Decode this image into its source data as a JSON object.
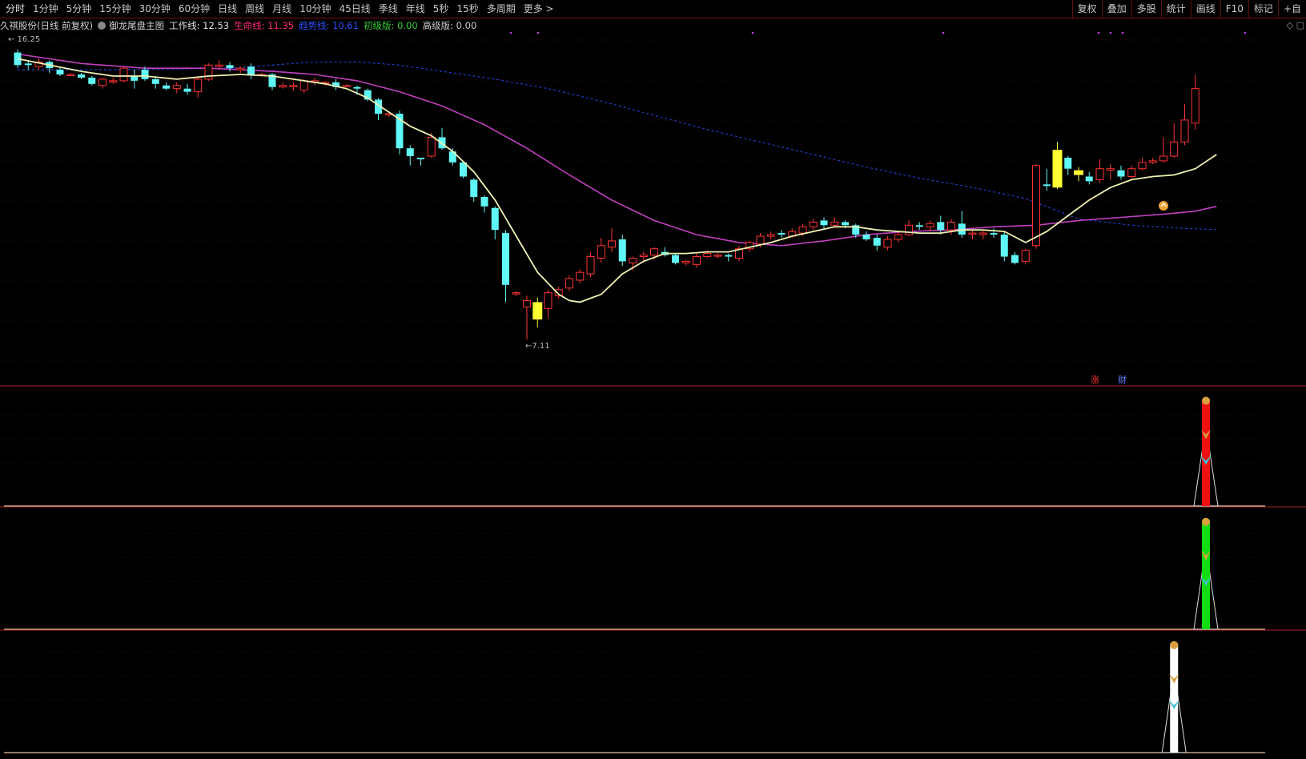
{
  "toolbar": {
    "periods": [
      "分时",
      "1分钟",
      "5分钟",
      "15分钟",
      "30分钟",
      "60分钟",
      "日线",
      "周线",
      "月线",
      "10分钟",
      "45日线",
      "季线",
      "年线",
      "5秒",
      "15秒",
      "多周期",
      "更多 >"
    ],
    "right": [
      "复权",
      "叠加",
      "多股",
      "统计",
      "画线",
      "F10",
      "标记",
      "+自"
    ]
  },
  "indicator_bar": {
    "stock": "久祺股份(日线 前复权)",
    "formula": "御龙尾盘主图",
    "work_line": "工作线: 12.53",
    "life_line": "生命线: 11.35",
    "trend_line": "趋势线: 10.61",
    "basic": "初级版: 0.00",
    "advanced": "高级版: 0.00"
  },
  "right_icons": "◇ ▢",
  "price_labels": {
    "high": "16.25",
    "low": "7.11"
  },
  "markers": {
    "zhang": "涨",
    "cai": "财"
  },
  "colors": {
    "up": "#ff3333",
    "down": "#5ff7f7",
    "special": "#ffff33",
    "work": "#f0f0b0",
    "life": "#c040c0",
    "trend": "#2040d0",
    "life_label": "#ff2a7a",
    "trend_label": "#3050ff",
    "basic_label": "#33cc33",
    "panel1": "#ee1111",
    "panel2": "#11dd11",
    "panel3": "#ffffff"
  },
  "chart_data": {
    "type": "candlestick",
    "ylim": [
      6.5,
      16.8
    ],
    "high_label": 16.25,
    "low_label": 7.11,
    "candles": [
      [
        16.25,
        15.85,
        16.35,
        15.75
      ],
      [
        15.9,
        15.85,
        16.0,
        15.7
      ],
      [
        15.8,
        15.95,
        16.05,
        15.7
      ],
      [
        15.95,
        15.75,
        16.0,
        15.6
      ],
      [
        15.7,
        15.55,
        15.8,
        15.5
      ],
      [
        15.55,
        15.55,
        15.6,
        15.5
      ],
      [
        15.55,
        15.45,
        15.6,
        15.4
      ],
      [
        15.45,
        15.25,
        15.5,
        15.2
      ],
      [
        15.2,
        15.4,
        15.45,
        15.1
      ],
      [
        15.35,
        15.35,
        15.45,
        15.25
      ],
      [
        15.35,
        15.75,
        15.8,
        15.3
      ],
      [
        15.5,
        15.35,
        15.7,
        15.1
      ],
      [
        15.7,
        15.4,
        15.8,
        15.35
      ],
      [
        15.4,
        15.25,
        15.5,
        15.1
      ],
      [
        15.2,
        15.1,
        15.3,
        15.05
      ],
      [
        15.1,
        15.2,
        15.3,
        14.95
      ],
      [
        15.1,
        15.0,
        15.25,
        14.9
      ],
      [
        15.0,
        15.4,
        15.45,
        14.8
      ],
      [
        15.4,
        15.85,
        15.9,
        15.35
      ],
      [
        15.8,
        15.85,
        16.0,
        15.7
      ],
      [
        15.85,
        15.75,
        15.95,
        15.65
      ],
      [
        15.7,
        15.75,
        15.8,
        15.6
      ],
      [
        15.8,
        15.55,
        15.9,
        15.4
      ],
      [
        15.55,
        15.55,
        15.6,
        15.5
      ],
      [
        15.55,
        15.15,
        15.6,
        15.05
      ],
      [
        15.15,
        15.2,
        15.3,
        15.1
      ],
      [
        15.2,
        15.2,
        15.3,
        15.05
      ],
      [
        15.05,
        15.35,
        15.4,
        14.95
      ],
      [
        15.3,
        15.35,
        15.45,
        15.2
      ],
      [
        15.3,
        15.3,
        15.35,
        15.2
      ],
      [
        15.3,
        15.15,
        15.4,
        15.05
      ],
      [
        15.2,
        15.2,
        15.25,
        15.15
      ],
      [
        15.15,
        15.1,
        15.2,
        14.9
      ],
      [
        15.05,
        14.75,
        15.1,
        14.7
      ],
      [
        14.75,
        14.3,
        14.8,
        14.1
      ],
      [
        14.3,
        14.3,
        14.35,
        14.2
      ],
      [
        14.3,
        13.2,
        14.4,
        13.0
      ],
      [
        13.2,
        12.95,
        13.3,
        12.65
      ],
      [
        12.9,
        12.85,
        12.9,
        12.65
      ],
      [
        12.95,
        13.55,
        13.7,
        12.9
      ],
      [
        13.55,
        13.2,
        13.85,
        13.15
      ],
      [
        13.1,
        12.75,
        13.2,
        12.65
      ],
      [
        12.75,
        12.3,
        12.8,
        12.25
      ],
      [
        12.2,
        11.65,
        12.25,
        11.5
      ],
      [
        11.65,
        11.35,
        11.7,
        11.15
      ],
      [
        11.3,
        10.6,
        11.35,
        10.3
      ],
      [
        10.5,
        8.85,
        10.6,
        8.3
      ],
      [
        8.6,
        8.6,
        8.65,
        8.5
      ],
      [
        8.15,
        8.35,
        8.5,
        7.11
      ],
      [
        7.75,
        8.3,
        8.45,
        7.5
      ],
      [
        8.1,
        8.6,
        8.7,
        7.8
      ],
      [
        8.5,
        8.7,
        8.8,
        8.4
      ],
      [
        8.75,
        9.05,
        9.15,
        8.65
      ],
      [
        9.0,
        9.25,
        9.35,
        8.9
      ],
      [
        9.2,
        9.75,
        9.9,
        9.1
      ],
      [
        9.7,
        10.1,
        10.35,
        9.55
      ],
      [
        10.05,
        10.25,
        10.65,
        9.9
      ],
      [
        10.3,
        9.6,
        10.45,
        9.45
      ],
      [
        9.55,
        9.7,
        9.75,
        9.3
      ],
      [
        9.75,
        9.8,
        9.9,
        9.6
      ],
      [
        9.8,
        10.0,
        10.05,
        9.65
      ],
      [
        9.9,
        9.8,
        10.05,
        9.75
      ],
      [
        9.8,
        9.55,
        9.85,
        9.5
      ],
      [
        9.55,
        9.6,
        9.65,
        9.45
      ],
      [
        9.5,
        9.75,
        9.85,
        9.4
      ],
      [
        9.75,
        9.85,
        9.95,
        9.7
      ],
      [
        9.8,
        9.8,
        9.85,
        9.7
      ],
      [
        9.8,
        9.75,
        9.85,
        9.6
      ],
      [
        9.7,
        10.0,
        10.1,
        9.6
      ],
      [
        10.0,
        10.2,
        10.25,
        9.9
      ],
      [
        10.15,
        10.4,
        10.5,
        10.05
      ],
      [
        10.4,
        10.45,
        10.55,
        10.3
      ],
      [
        10.5,
        10.45,
        10.6,
        10.35
      ],
      [
        10.4,
        10.55,
        10.65,
        10.35
      ],
      [
        10.5,
        10.7,
        10.8,
        10.4
      ],
      [
        10.7,
        10.85,
        10.95,
        10.6
      ],
      [
        10.9,
        10.75,
        11.0,
        10.6
      ],
      [
        10.75,
        10.85,
        11.0,
        10.7
      ],
      [
        10.85,
        10.75,
        10.9,
        10.65
      ],
      [
        10.75,
        10.45,
        10.8,
        10.35
      ],
      [
        10.45,
        10.3,
        10.55,
        10.25
      ],
      [
        10.35,
        10.1,
        10.45,
        9.95
      ],
      [
        10.05,
        10.3,
        10.4,
        9.95
      ],
      [
        10.3,
        10.45,
        10.55,
        10.2
      ],
      [
        10.45,
        10.75,
        10.9,
        10.4
      ],
      [
        10.75,
        10.7,
        10.85,
        10.6
      ],
      [
        10.7,
        10.8,
        10.9,
        10.55
      ],
      [
        10.85,
        10.6,
        11.05,
        10.45
      ],
      [
        10.6,
        10.85,
        10.95,
        10.45
      ],
      [
        10.8,
        10.45,
        11.2,
        10.35
      ],
      [
        10.5,
        10.5,
        10.6,
        10.3
      ],
      [
        10.45,
        10.5,
        10.6,
        10.3
      ],
      [
        10.5,
        10.45,
        10.65,
        10.35
      ],
      [
        10.45,
        9.75,
        10.55,
        9.6
      ],
      [
        9.8,
        9.55,
        9.9,
        9.5
      ],
      [
        9.6,
        9.95,
        10.0,
        9.5
      ],
      [
        10.1,
        12.65,
        12.7,
        10.0
      ],
      [
        12.05,
        12.0,
        12.55,
        11.85
      ],
      [
        11.95,
        13.15,
        13.4,
        11.9
      ],
      [
        12.9,
        12.55,
        12.95,
        12.35
      ],
      [
        12.5,
        12.35,
        12.6,
        12.15
      ],
      [
        12.3,
        12.15,
        12.45,
        12.05
      ],
      [
        12.2,
        12.55,
        12.85,
        12.1
      ],
      [
        12.5,
        12.55,
        12.7,
        12.2
      ],
      [
        12.5,
        12.3,
        12.65,
        12.2
      ],
      [
        12.3,
        12.55,
        12.65,
        12.25
      ],
      [
        12.55,
        12.75,
        12.9,
        12.5
      ],
      [
        12.75,
        12.8,
        12.9,
        12.7
      ],
      [
        12.8,
        12.95,
        13.55,
        12.75
      ],
      [
        12.95,
        13.4,
        14.0,
        12.9
      ],
      [
        13.4,
        14.1,
        14.6,
        13.3
      ],
      [
        14.0,
        15.1,
        15.55,
        13.8
      ]
    ],
    "special": [
      49,
      98,
      100
    ],
    "work_line": [
      [
        0,
        16.05
      ],
      [
        3,
        15.85
      ],
      [
        6,
        15.65
      ],
      [
        9,
        15.5
      ],
      [
        12,
        15.5
      ],
      [
        15,
        15.4
      ],
      [
        18,
        15.5
      ],
      [
        21,
        15.55
      ],
      [
        24,
        15.5
      ],
      [
        27,
        15.35
      ],
      [
        29,
        15.25
      ],
      [
        31,
        15.1
      ],
      [
        33,
        14.8
      ],
      [
        35,
        14.35
      ],
      [
        37,
        13.9
      ],
      [
        39,
        13.6
      ],
      [
        41,
        13.1
      ],
      [
        43,
        12.45
      ],
      [
        45,
        11.55
      ],
      [
        47,
        10.4
      ],
      [
        49,
        9.25
      ],
      [
        51,
        8.55
      ],
      [
        52,
        8.35
      ],
      [
        53,
        8.3
      ],
      [
        55,
        8.55
      ],
      [
        57,
        9.2
      ],
      [
        59,
        9.6
      ],
      [
        61,
        9.85
      ],
      [
        63,
        9.85
      ],
      [
        65,
        9.9
      ],
      [
        67,
        9.9
      ],
      [
        69,
        10.05
      ],
      [
        71,
        10.2
      ],
      [
        73,
        10.4
      ],
      [
        75,
        10.55
      ],
      [
        77,
        10.7
      ],
      [
        79,
        10.7
      ],
      [
        81,
        10.6
      ],
      [
        83,
        10.55
      ],
      [
        85,
        10.5
      ],
      [
        87,
        10.5
      ],
      [
        89,
        10.6
      ],
      [
        91,
        10.6
      ],
      [
        93,
        10.55
      ],
      [
        95,
        10.2
      ],
      [
        97,
        10.55
      ],
      [
        99,
        11.05
      ],
      [
        101,
        11.55
      ],
      [
        103,
        11.95
      ],
      [
        105,
        12.2
      ],
      [
        107,
        12.3
      ],
      [
        109,
        12.35
      ],
      [
        111,
        12.55
      ],
      [
        113,
        13.0
      ]
    ],
    "life_line": [
      [
        0,
        16.2
      ],
      [
        6,
        15.9
      ],
      [
        12,
        15.75
      ],
      [
        18,
        15.75
      ],
      [
        24,
        15.65
      ],
      [
        28,
        15.55
      ],
      [
        32,
        15.35
      ],
      [
        36,
        15.0
      ],
      [
        40,
        14.55
      ],
      [
        44,
        13.95
      ],
      [
        48,
        13.2
      ],
      [
        52,
        12.35
      ],
      [
        56,
        11.55
      ],
      [
        60,
        10.9
      ],
      [
        64,
        10.45
      ],
      [
        68,
        10.2
      ],
      [
        72,
        10.1
      ],
      [
        76,
        10.25
      ],
      [
        80,
        10.45
      ],
      [
        84,
        10.55
      ],
      [
        88,
        10.6
      ],
      [
        92,
        10.7
      ],
      [
        96,
        10.75
      ],
      [
        100,
        10.9
      ],
      [
        104,
        11.0
      ],
      [
        108,
        11.1
      ],
      [
        111,
        11.2
      ],
      [
        113,
        11.35
      ]
    ],
    "trend_line": [
      [
        0,
        15.7
      ],
      [
        10,
        15.7
      ],
      [
        20,
        15.75
      ],
      [
        28,
        15.95
      ],
      [
        32,
        15.95
      ],
      [
        36,
        15.85
      ],
      [
        40,
        15.65
      ],
      [
        45,
        15.4
      ],
      [
        50,
        15.1
      ],
      [
        55,
        14.7
      ],
      [
        60,
        14.25
      ],
      [
        65,
        13.8
      ],
      [
        70,
        13.4
      ],
      [
        75,
        13.0
      ],
      [
        80,
        12.6
      ],
      [
        85,
        12.25
      ],
      [
        90,
        11.95
      ],
      [
        95,
        11.6
      ],
      [
        100,
        10.95
      ],
      [
        105,
        10.75
      ],
      [
        110,
        10.65
      ],
      [
        113,
        10.61
      ]
    ]
  },
  "signal_panels": [
    {
      "index": 112,
      "level": 0.94,
      "color": "#ee1111"
    },
    {
      "index": 112,
      "level": 0.94,
      "color": "#11dd11"
    },
    {
      "index": 109,
      "level": 0.94,
      "color": "#ffffff"
    }
  ],
  "dollar_marker_index": 108
}
